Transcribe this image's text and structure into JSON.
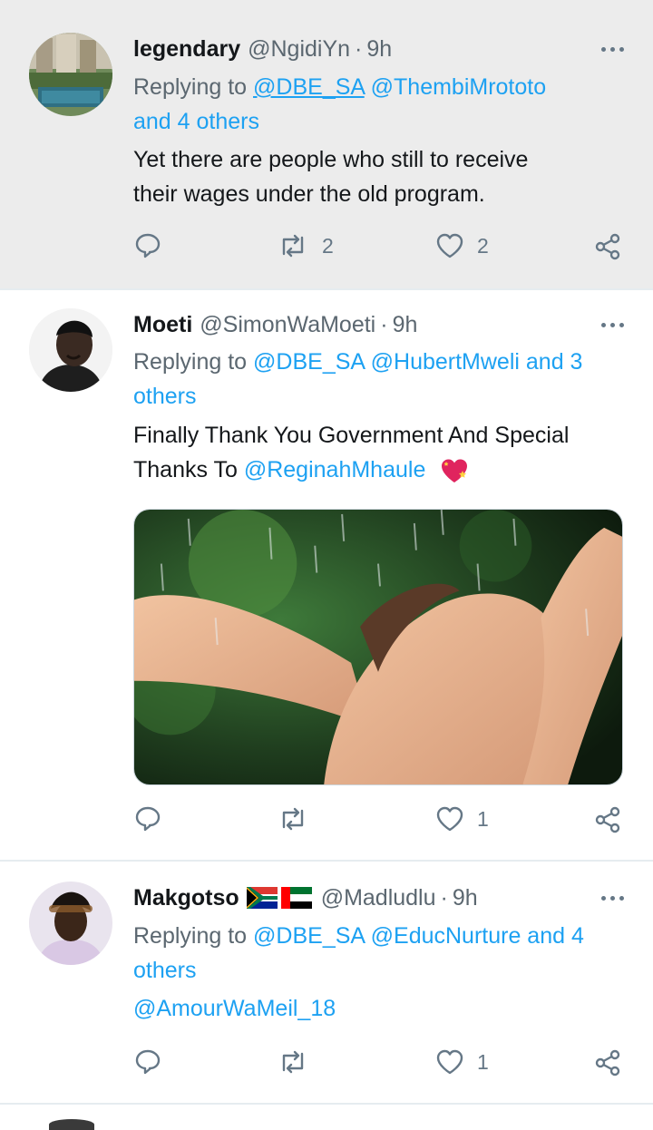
{
  "tweets": [
    {
      "name": "legendary",
      "handle": "@NgidiYn",
      "dot": "·",
      "time": "9h",
      "replying_prefix": "Replying to",
      "replying_line1_links": [
        "@DBE_SA",
        "@ThembiMrototo"
      ],
      "replying_line2": "and 4 others",
      "body_line1": "Yet there are people who still to receive",
      "body_line2": "their wages under the old program.",
      "retweets": "2",
      "likes": "2"
    },
    {
      "name": "Moeti",
      "handle": "@SimonWaMoeti",
      "dot": "·",
      "time": "9h",
      "replying_prefix": "Replying to",
      "replying_line1_links": [
        "@DBE_SA",
        "@HubertMweli and 3"
      ],
      "replying_line2": "others",
      "body_line1": "Finally Thank You Government And Special",
      "body_line2_prefix": "Thanks To",
      "body_line2_link": "@ReginahMhaule",
      "retweets": "",
      "likes": "1"
    },
    {
      "name": "Makgotso",
      "handle": "@Madludlu",
      "dot": "·",
      "time": "9h",
      "replying_prefix": "Replying to",
      "replying_line1_links": [
        "@DBE_SA",
        "@EducNurture and 4"
      ],
      "replying_line2": "others",
      "body_link": "@AmourWaMeil_18",
      "retweets": "",
      "likes": "1"
    }
  ],
  "icons": {
    "reply": "reply-icon",
    "retweet": "retweet-icon",
    "like": "heart-icon",
    "share": "share-icon",
    "more": "more-icon",
    "sparkling_heart": "sparkling-heart-emoji",
    "flag_za": "south-africa-flag",
    "flag_ae": "uae-flag"
  },
  "colors": {
    "link": "#1da1f2",
    "secondary_text": "#5b6770",
    "highlight_bg": "#ececec"
  }
}
